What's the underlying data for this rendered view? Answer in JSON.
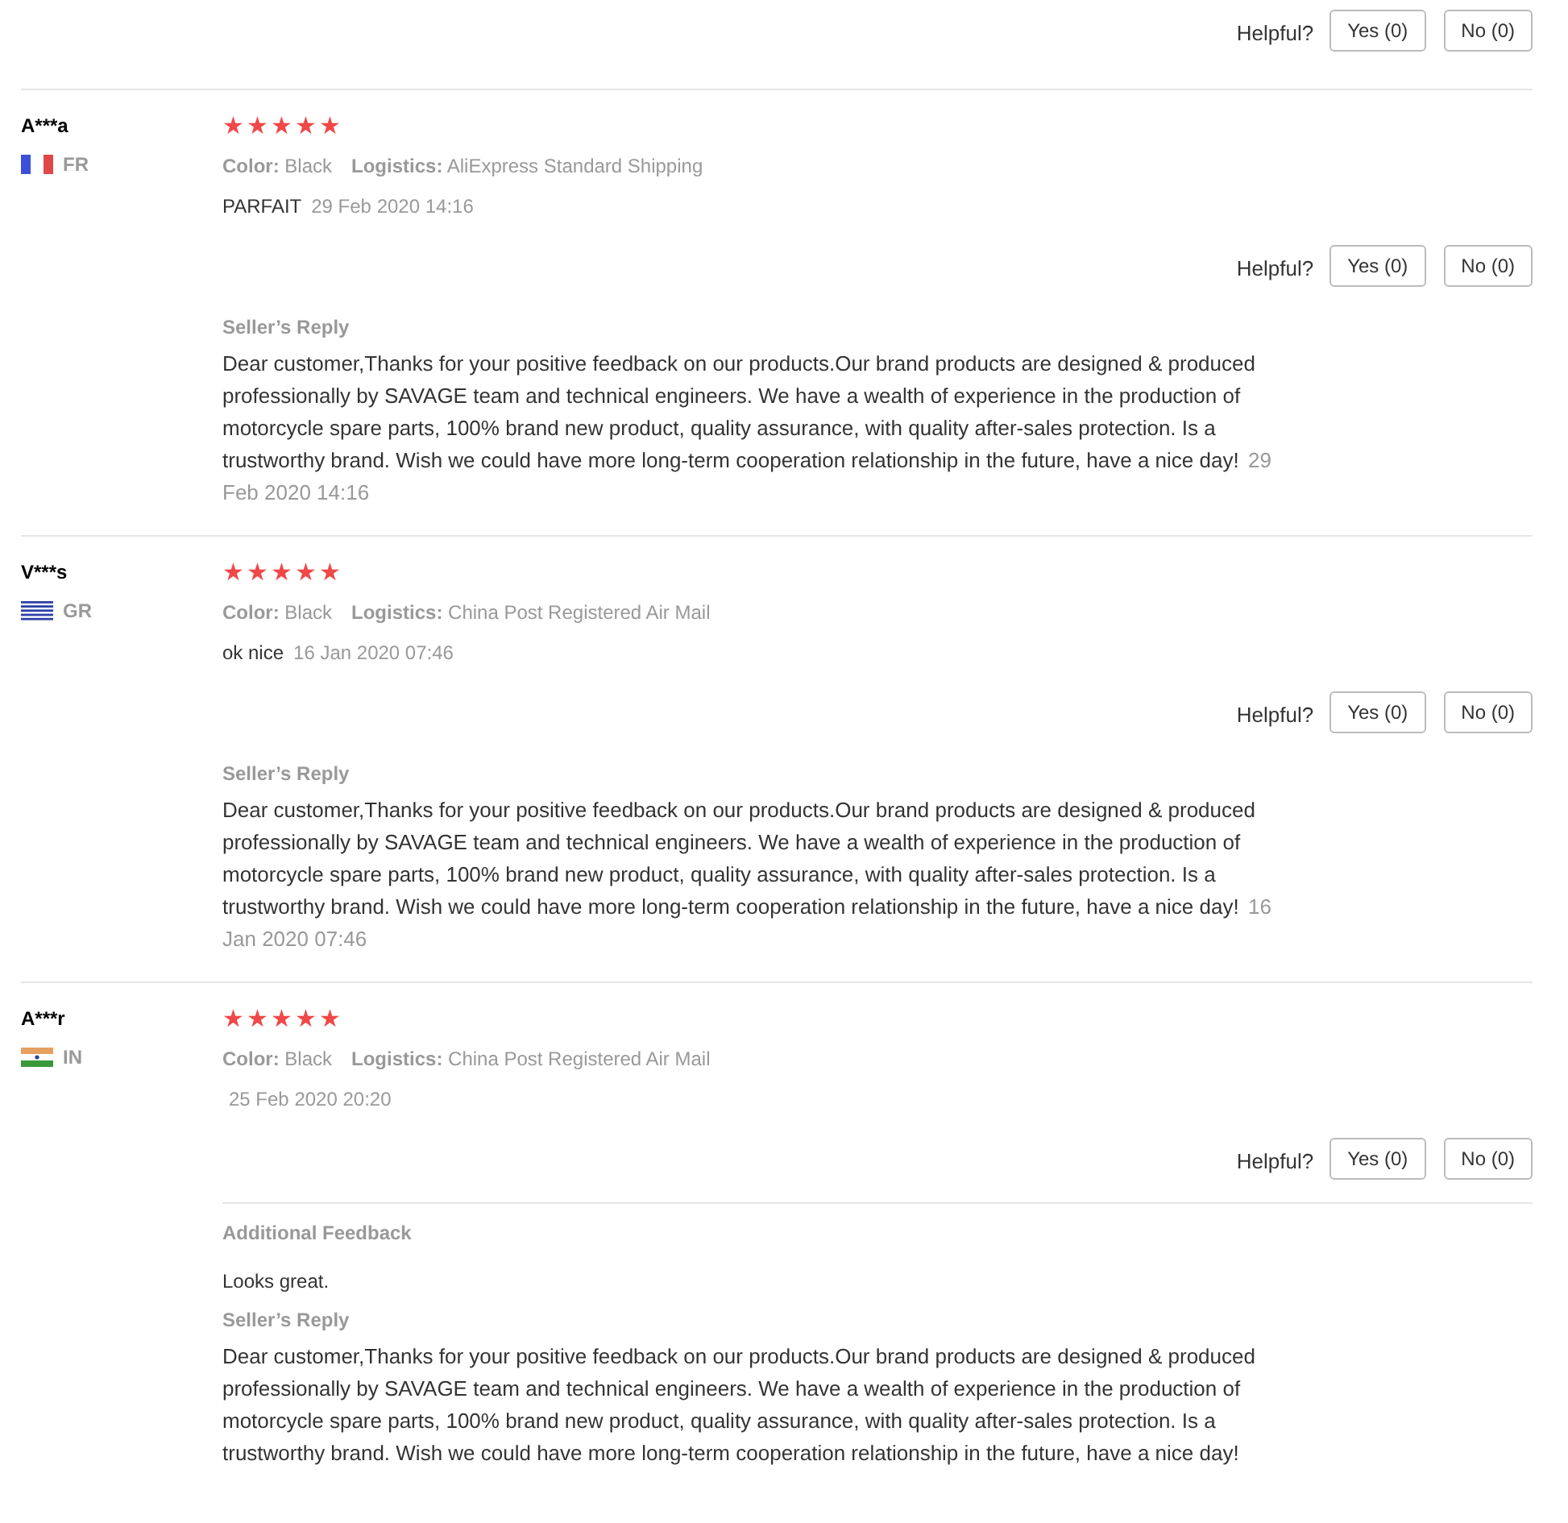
{
  "top_helpful": {
    "label": "Helpful?",
    "yes": "Yes (0)",
    "no": "No (0)"
  },
  "reviews": [
    {
      "name": "A***a",
      "kind": "fr",
      "country": "FR",
      "stars": 5,
      "color_label": "Color:",
      "product_color": "Black",
      "logistics_label": "Logistics:",
      "logistics": "AliExpress Standard Shipping",
      "comment": "PARFAIT",
      "date": "29 Feb 2020 14:16",
      "helpful": {
        "label": "Helpful?",
        "yes": "Yes (0)",
        "no": "No (0)"
      },
      "reply_title": "Seller’s Reply",
      "reply": "Dear customer,Thanks for your positive feedback on our products.Our brand products are designed & produced professionally by SAVAGE team and technical engineers. We have a wealth of experience in the production of motorcycle spare parts, 100% brand new product, quality assurance, with quality after-sales protection. Is a trustworthy brand. Wish we could have more long-term cooperation relationship in the future, have a nice day!",
      "reply_date": "29 Feb 2020 14:16"
    },
    {
      "name": "V***s",
      "kind": "gr",
      "country": "GR",
      "stars": 5,
      "color_label": "Color:",
      "product_color": "Black",
      "logistics_label": "Logistics:",
      "logistics": "China Post Registered Air Mail",
      "comment": "ok nice",
      "date": "16 Jan 2020 07:46",
      "helpful": {
        "label": "Helpful?",
        "yes": "Yes (0)",
        "no": "No (0)"
      },
      "reply_title": "Seller’s Reply",
      "reply": "Dear customer,Thanks for your positive feedback on our products.Our brand products are designed & produced professionally by SAVAGE team and technical engineers. We have a wealth of experience in the production of motorcycle spare parts, 100% brand new product, quality assurance, with quality after-sales protection. Is a trustworthy brand. Wish we could have more long-term cooperation relationship in the future, have a nice day!",
      "reply_date": "16 Jan 2020 07:46"
    },
    {
      "name": "A***r",
      "kind": "in",
      "country": "IN",
      "stars": 5,
      "color_label": "Color:",
      "product_color": "Black",
      "logistics_label": "Logistics:",
      "logistics": "China Post Registered Air Mail",
      "date": "25 Feb 2020 20:20",
      "helpful": {
        "label": "Helpful?",
        "yes": "Yes (0)",
        "no": "No (0)"
      },
      "additional_title": "Additional Feedback",
      "additional": "Looks great.",
      "reply_title": "Seller’s Reply",
      "reply": "Dear customer,Thanks for your positive feedback on our products.Our brand products are designed & produced professionally by SAVAGE team and technical engineers. We have a wealth of experience in the production of motorcycle spare parts, 100% brand new product, quality assurance, with quality after-sales protection. Is a trustworthy brand. Wish we could have more long-term cooperation relationship in the future, have a nice day!"
    }
  ]
}
